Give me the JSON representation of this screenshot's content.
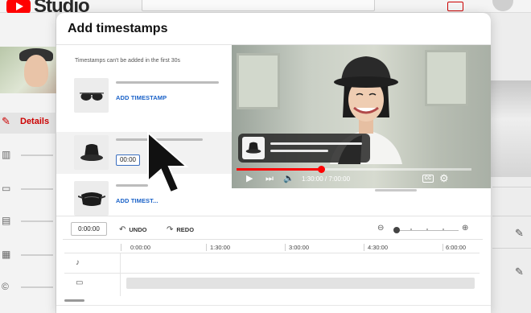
{
  "app": {
    "logo_text": "Studio",
    "brand_color": "#ff0000"
  },
  "sidebar": {
    "details_label": "Details",
    "accent_color": "#cc0000"
  },
  "modal": {
    "title": "Add timestamps",
    "hint": "Timestamps can't be added in the first 30s",
    "items": [
      {
        "thumb_icon": "sunglasses-icon",
        "link_label": "ADD TIMESTAMP"
      },
      {
        "thumb_icon": "bucket-hat-icon",
        "time_chip": "00:00"
      },
      {
        "thumb_icon": "belt-bag-icon",
        "link_label": "ADD TIMEST..."
      }
    ],
    "link_color": "#1a62c8"
  },
  "player": {
    "time_readout": "1:30:00 / 7:00:00",
    "progress_fraction": 0.36,
    "overlay_icon": "bucket-hat-icon",
    "progress_color": "#ff0000"
  },
  "timeline": {
    "time_input": "0:00:00",
    "undo_label": "UNDO",
    "redo_label": "REDO",
    "ticks": [
      "0:00:00",
      "1:30:00",
      "3:00:00",
      "4:30:00",
      "6:00:00"
    ],
    "tracks": [
      {
        "icon": "music-note-icon"
      },
      {
        "icon": "video-camera-icon"
      }
    ]
  }
}
